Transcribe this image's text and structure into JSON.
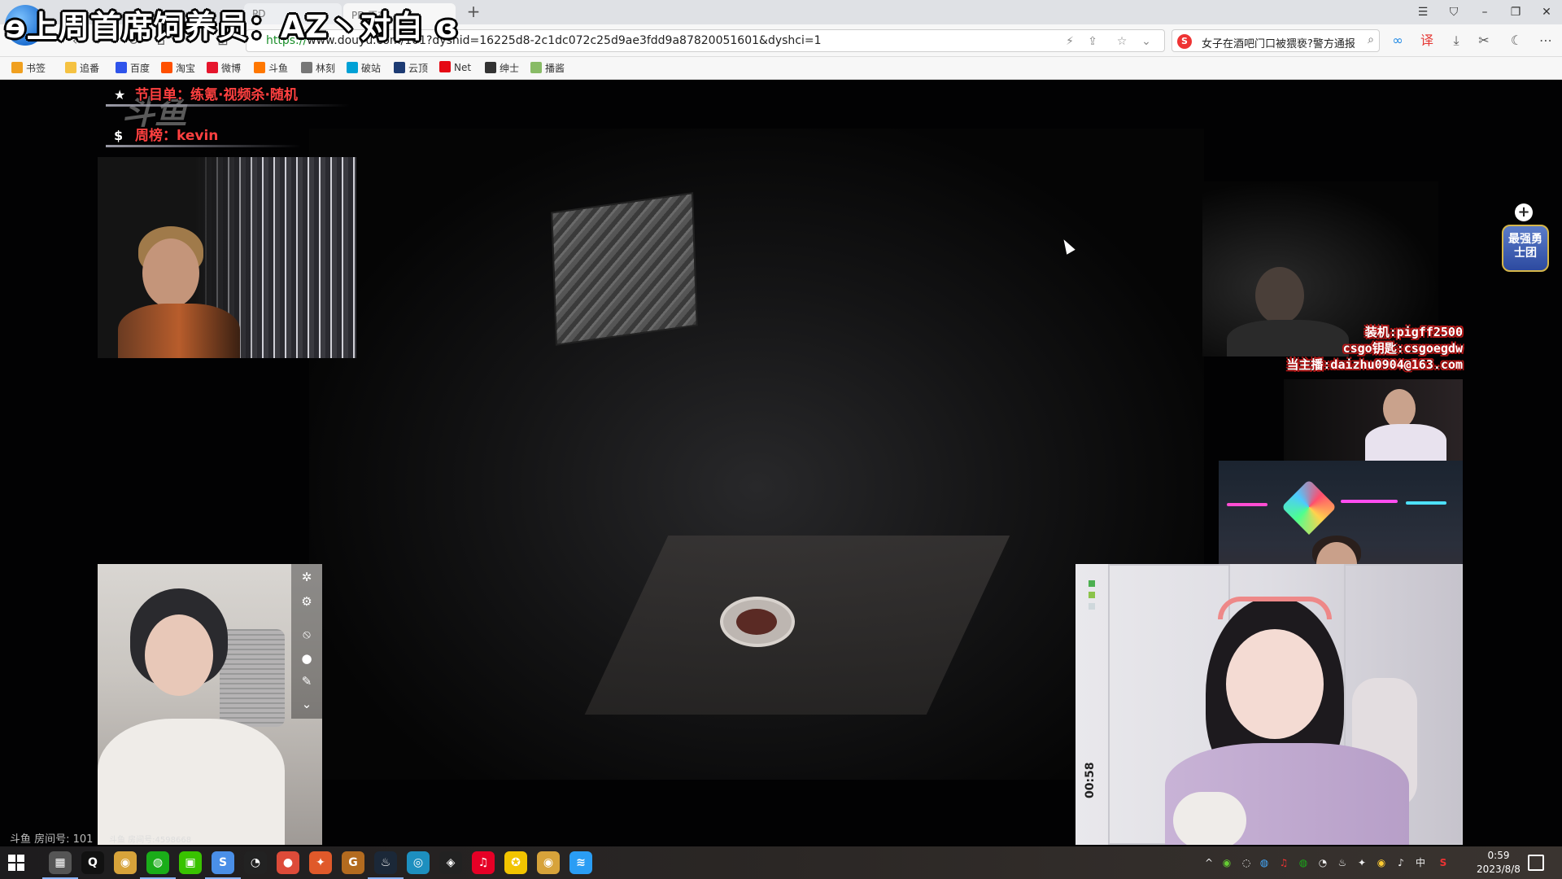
{
  "overlay": {
    "title": "ɘ上周首席饲养员：AZ丶对白 ɞ"
  },
  "browser": {
    "tabs": [
      {
        "label": "PD"
      },
      {
        "label": "PD 正在"
      }
    ],
    "new_tab": "+",
    "url_scheme": "https://",
    "url_rest": "www.douyu.com/101?dyshid=16225d8-2c1dc072c25d9ae3fdd9a87820051601&dyshci=1",
    "search_text": "女子在酒吧门口被猥亵?警方通报"
  },
  "bookmarks": [
    {
      "label": "书签",
      "color": "#f0a020"
    },
    {
      "label": "追番",
      "color": "#f5c242"
    },
    {
      "label": "百度",
      "color": "#2f54eb"
    },
    {
      "label": "淘宝",
      "color": "#ff5000"
    },
    {
      "label": "微博",
      "color": "#e6162d"
    },
    {
      "label": "斗鱼",
      "color": "#ff7700"
    },
    {
      "label": "林刻",
      "color": "#777777"
    },
    {
      "label": "破站",
      "color": "#00a1d6"
    },
    {
      "label": "云顶",
      "color": "#1d3b73"
    },
    {
      "label": "Net",
      "color": "#e50914"
    },
    {
      "label": "绅士",
      "color": "#333333"
    },
    {
      "label": "播酱",
      "color": "#88bb66"
    }
  ],
  "stream": {
    "program_list": "节目单：练氪·视频杀·随机",
    "weekly_rank": "周榜：kevin",
    "watermark": "斗鱼",
    "sponsor_lines": [
      "装机:pigff2500",
      "csgo钥匙:csgoegdw",
      "当主播:daizhu0904@163.com"
    ],
    "badge_text": "最强勇士团",
    "timer": "00:58",
    "room_info_left": "斗鱼 房间号: 101",
    "room_info_cam": "斗鱼 房间号:4598668"
  },
  "taskbar": {
    "apps": [
      {
        "name": "file-explorer",
        "glyph": "▦",
        "color": "#555555"
      },
      {
        "name": "qq",
        "glyph": "Q",
        "color": "#111111"
      },
      {
        "name": "app-owl",
        "glyph": "◉",
        "color": "#d7a33a"
      },
      {
        "name": "wechat",
        "glyph": "◍",
        "color": "#1aad19"
      },
      {
        "name": "app-green",
        "glyph": "▣",
        "color": "#39c300"
      },
      {
        "name": "app-s",
        "glyph": "S",
        "color": "#4a8fe7"
      },
      {
        "name": "app-gauge",
        "glyph": "◔",
        "color": "#222222"
      },
      {
        "name": "chrome",
        "glyph": "●",
        "color": "#dd4b39"
      },
      {
        "name": "app-bird",
        "glyph": "✦",
        "color": "#e0592a"
      },
      {
        "name": "app-g",
        "glyph": "G",
        "color": "#b36b1f"
      },
      {
        "name": "steam",
        "glyph": "♨",
        "color": "#1b2838"
      },
      {
        "name": "app-ring",
        "glyph": "◎",
        "color": "#1d8fbf"
      },
      {
        "name": "app-target",
        "glyph": "◈",
        "color": "#222222"
      },
      {
        "name": "netease-music",
        "glyph": "♫",
        "color": "#e60026"
      },
      {
        "name": "app-yellow",
        "glyph": "✪",
        "color": "#f2c400"
      },
      {
        "name": "app-owl-2",
        "glyph": "◉",
        "color": "#d7a33a"
      },
      {
        "name": "app-audio",
        "glyph": "≋",
        "color": "#2a9df4"
      }
    ],
    "tray_lang": "中",
    "time": "0:59",
    "date": "2023/8/8"
  }
}
